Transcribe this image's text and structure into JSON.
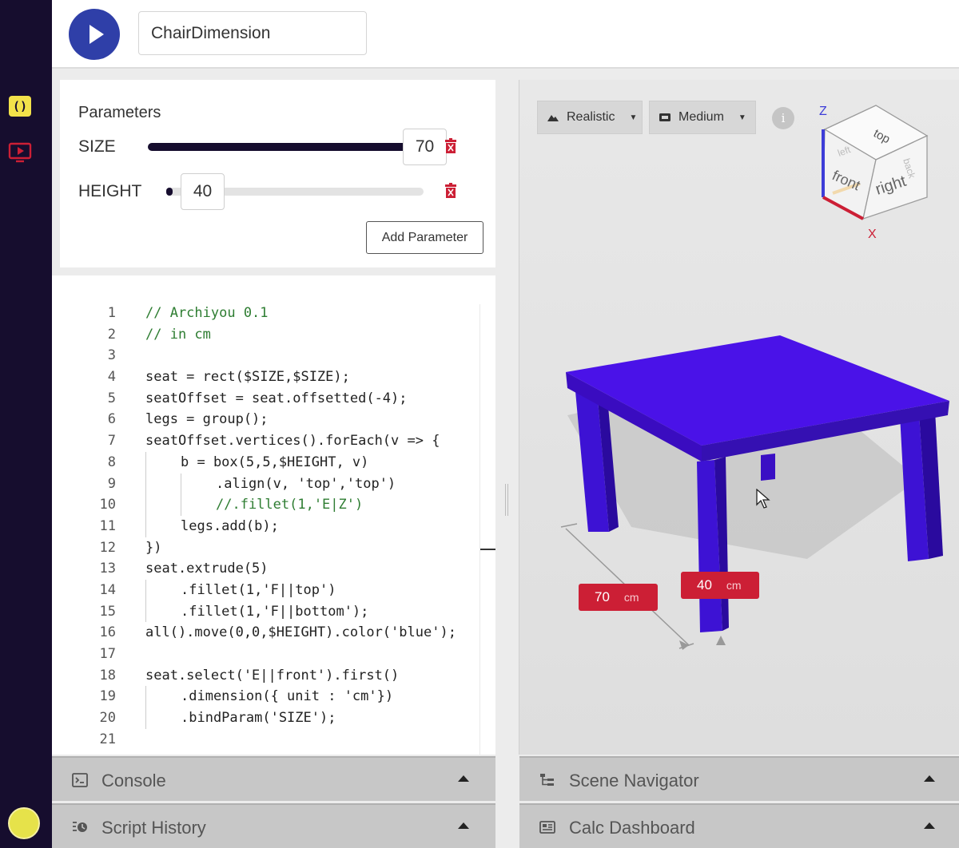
{
  "toolbar": {
    "script_name": "ChairDimension"
  },
  "parameters": {
    "title": "Parameters",
    "items": [
      {
        "name": "SIZE",
        "value": "70",
        "fill_fraction": 1.0
      },
      {
        "name": "HEIGHT",
        "value": "40",
        "fill_fraction": 0.0
      }
    ],
    "add_label": "Add Parameter"
  },
  "editor": {
    "lines": [
      {
        "n": "1",
        "text": "// Archiyou 0.1",
        "indent": 0
      },
      {
        "n": "2",
        "text": "// in cm",
        "indent": 0
      },
      {
        "n": "3",
        "text": "",
        "indent": 0
      },
      {
        "n": "4",
        "text": "seat = rect($SIZE,$SIZE);",
        "indent": 0
      },
      {
        "n": "5",
        "text": "seatOffset = seat.offsetted(-4);",
        "indent": 0
      },
      {
        "n": "6",
        "text": "legs = group();",
        "indent": 0
      },
      {
        "n": "7",
        "text": "seatOffset.vertices().forEach(v => {",
        "indent": 0
      },
      {
        "n": "8",
        "text": "b = box(5,5,$HEIGHT, v)",
        "indent": 1
      },
      {
        "n": "9",
        "text": ".align(v, 'top','top')",
        "indent": 2
      },
      {
        "n": "10",
        "text": "//.fillet(1,'E|Z')",
        "indent": 2
      },
      {
        "n": "11",
        "text": "legs.add(b);",
        "indent": 1
      },
      {
        "n": "12",
        "text": "})",
        "indent": 0
      },
      {
        "n": "13",
        "text": "seat.extrude(5)",
        "indent": 0
      },
      {
        "n": "14",
        "text": ".fillet(1,'F||top')",
        "indent": 1
      },
      {
        "n": "15",
        "text": ".fillet(1,'F||bottom');",
        "indent": 1
      },
      {
        "n": "16",
        "text": "all().move(0,0,$HEIGHT).color('blue');",
        "indent": 0
      },
      {
        "n": "17",
        "text": "",
        "indent": 0
      },
      {
        "n": "18",
        "text": "seat.select('E||front').first()",
        "indent": 0
      },
      {
        "n": "19",
        "text": ".dimension({ unit : 'cm'})",
        "indent": 1
      },
      {
        "n": "20",
        "text": ".bindParam('SIZE');",
        "indent": 1
      },
      {
        "n": "21",
        "text": "",
        "indent": 0
      }
    ]
  },
  "viewport": {
    "render_mode": "Realistic",
    "quality": "Medium",
    "info_label": "i",
    "cube": {
      "top": "top",
      "front": "front",
      "right": "right",
      "back": "back",
      "left": "left",
      "axis_z": "Z",
      "axis_x": "X"
    },
    "dimensions": [
      {
        "value": "70",
        "unit": "cm"
      },
      {
        "value": "40",
        "unit": "cm"
      }
    ],
    "object_color": "#4a12e8"
  },
  "panels": {
    "console": "Console",
    "history": "Script History",
    "scene": "Scene Navigator",
    "calc": "Calc Dashboard"
  },
  "colors": {
    "rail": "#160d2e",
    "accent": "#2f3fa8",
    "danger": "#cc1f35",
    "code_comment": "#2e7d32",
    "code_string": "#a31515"
  }
}
